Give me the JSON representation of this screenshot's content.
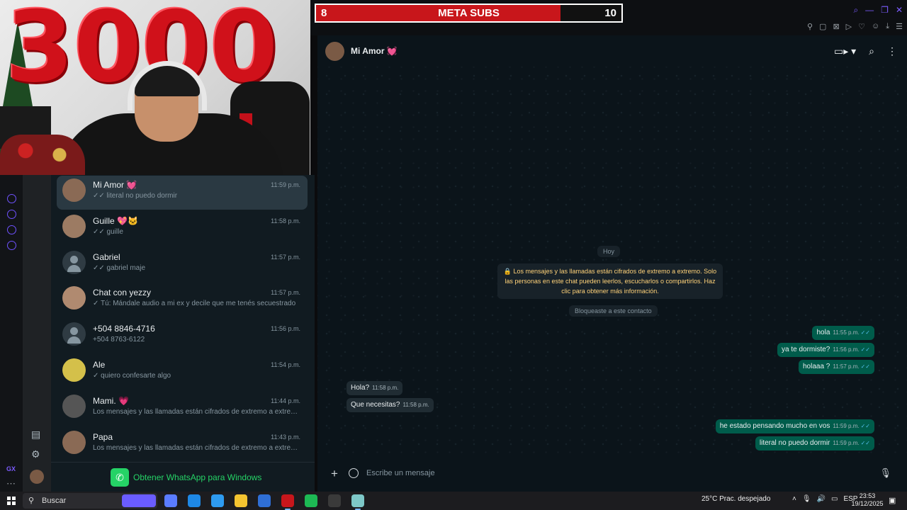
{
  "webcam": {
    "balloon_text": "3000"
  },
  "sub_goal": {
    "current": "8",
    "title": "META SUBS",
    "target": "10",
    "progress_fraction": 0.8,
    "fill_color": "#c8161b"
  },
  "chat_list": [
    {
      "name": "Mi Amor 💓",
      "time": "11:59 p.m.",
      "preview": "✓✓ literal no puedo dormir",
      "active": true,
      "avatar": "photo"
    },
    {
      "name": "Guille 💖🐱",
      "time": "11:58 p.m.",
      "preview": "✓✓ guille",
      "active": false,
      "avatar": "photo"
    },
    {
      "name": "Gabriel",
      "time": "11:57 p.m.",
      "preview": "✓✓ gabriel maje",
      "active": false,
      "avatar": "generic"
    },
    {
      "name": "Chat con yezzy",
      "time": "11:57 p.m.",
      "preview": "✓ Tú: Mándale audio a mi ex y decile que me tenés secuestrado",
      "active": false,
      "avatar": "photo"
    },
    {
      "name": "+504 8846-4716",
      "time": "11:56 p.m.",
      "preview": "+504 8763-6122",
      "active": false,
      "avatar": "generic"
    },
    {
      "name": "Ale",
      "time": "11:54 p.m.",
      "preview": "✓ quiero confesarte algo",
      "active": false,
      "avatar": "photo"
    },
    {
      "name": "Mami. 💗",
      "time": "11:44 p.m.",
      "preview": "Los mensajes y las llamadas están cifrados de extremo a extremo. ...",
      "active": false,
      "avatar": "photo"
    },
    {
      "name": "Papa",
      "time": "11:43 p.m.",
      "preview": "Los mensajes y las llamadas están cifrados de extremo a extremo. ...",
      "active": false,
      "avatar": "photo"
    }
  ],
  "get_whatsapp_label": "Obtener WhatsApp para Windows",
  "chat": {
    "contact_name": "Mi Amor 💓",
    "day_label": "Hoy",
    "encryption_notice": "🔒 Los mensajes y las llamadas están cifrados de extremo a extremo. Solo las personas en este chat pueden leerlos, escucharlos o compartirlos. Haz clic para obtener más información.",
    "blocked_notice": "Bloqueaste a este contacto",
    "messages": [
      {
        "dir": "out",
        "text": "hola",
        "time": "11:55 p.m."
      },
      {
        "dir": "out",
        "text": "ya te dormiste?",
        "time": "11:56 p.m."
      },
      {
        "dir": "out",
        "text": "holaaa ?",
        "time": "11:57 p.m."
      },
      {
        "dir": "in",
        "text": "Hola?",
        "time": "11:58 p.m."
      },
      {
        "dir": "in",
        "text": "Que necesitas?",
        "time": "11:58 p.m."
      },
      {
        "dir": "out",
        "text": "he estado pensando mucho en vos",
        "time": "11:59 p.m."
      },
      {
        "dir": "out",
        "text": "literal no puedo dormir",
        "time": "11:59 p.m."
      }
    ],
    "composer_placeholder": "Escribe un mensaje"
  },
  "taskbar": {
    "search_label": "Buscar",
    "weather": "25°C  Prac. despejado",
    "language": "ESP",
    "time": "23:53",
    "date": "19/12/2025",
    "notification_count": "5",
    "app_colors": [
      "#5b7cff",
      "#1e88e5",
      "#2e9bf0",
      "#f4c430",
      "#2f6fd6",
      "#c8161b",
      "#1db954",
      "#3a3a3a",
      "#7ec8c8",
      "#6a5cff"
    ]
  }
}
